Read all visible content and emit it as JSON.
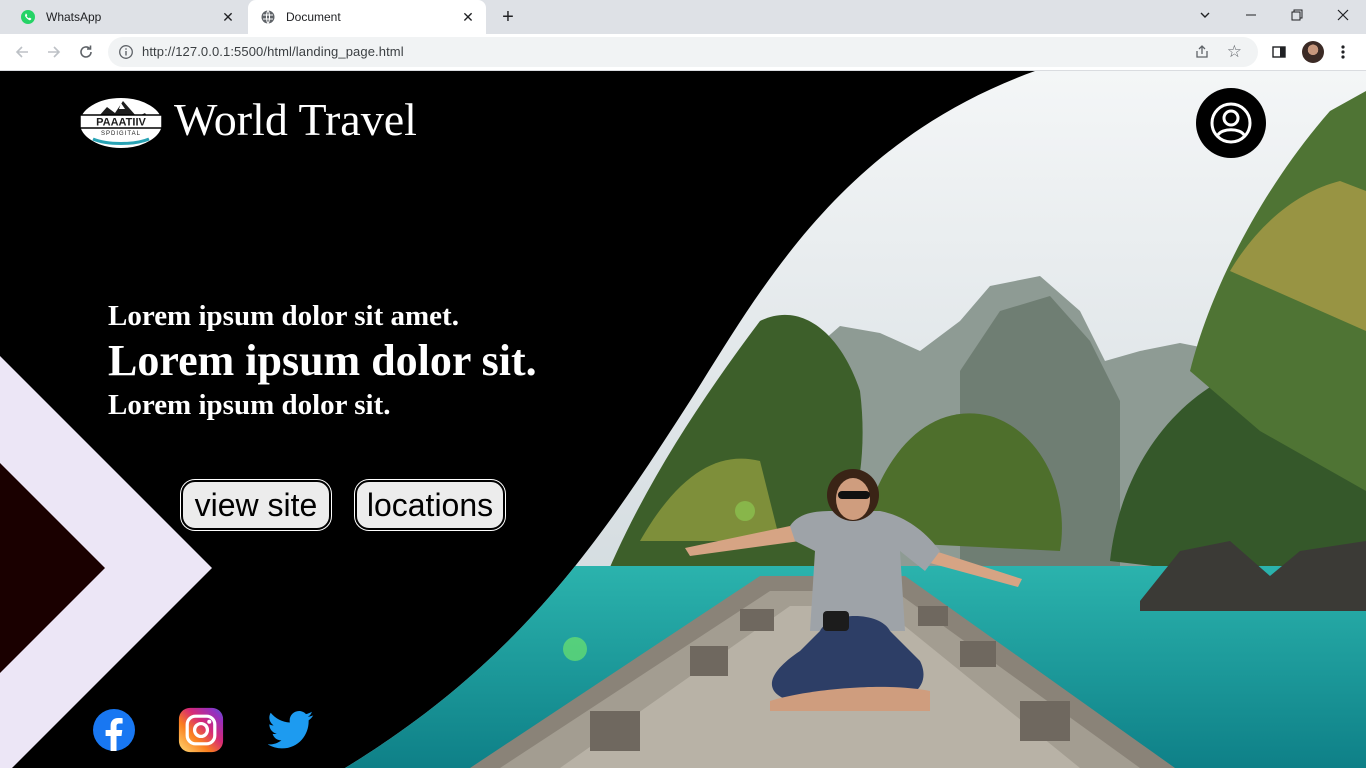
{
  "browser": {
    "tabs": [
      {
        "title": "WhatsApp",
        "active": false,
        "favicon": "whatsapp-icon"
      },
      {
        "title": "Document",
        "active": true,
        "favicon": "globe-icon"
      }
    ],
    "url": "http://127.0.0.1:5500/html/landing_page.html"
  },
  "header": {
    "logo_text": "PAAATIIV",
    "logo_subtext": "SPDIGITAL",
    "brand": "World Travel"
  },
  "hero": {
    "line1": "Lorem ipsum dolor sit amet.",
    "line2": "Lorem ipsum dolor sit.",
    "line3": "Lorem ipsum dolor sit."
  },
  "buttons": {
    "view_site": "view site",
    "locations": "locations"
  },
  "social": [
    "facebook-icon",
    "instagram-icon",
    "twitter-icon"
  ],
  "colors": {
    "page_background": "#000000",
    "chevron": "#ece6f6",
    "chevron_inner": "#1a0000",
    "button_fill": "#ececec",
    "water": "#1aa3a0",
    "sky": "#e8eef0",
    "facebook": "#1877f2",
    "twitter": "#1d9bf0"
  }
}
